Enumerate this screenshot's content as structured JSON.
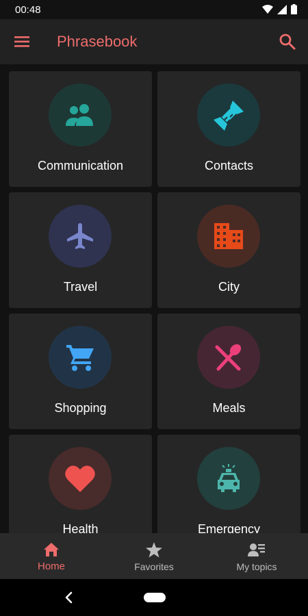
{
  "status_bar": {
    "time": "00:48",
    "icons": [
      "wifi-icon",
      "signal-icon",
      "battery-icon"
    ]
  },
  "app_bar": {
    "title": "Phrasebook",
    "menu_icon": "hamburger-menu-icon",
    "search_icon": "search-icon",
    "accent_color": "#ef6c6c"
  },
  "topics": [
    {
      "label": "Communication",
      "icon": "people-icon",
      "icon_color": "#26a69a",
      "circle_color": "#1d3936"
    },
    {
      "label": "Contacts",
      "icon": "handshake-icon",
      "icon_color": "#26c6da",
      "circle_color": "#1b3a3d"
    },
    {
      "label": "Travel",
      "icon": "airplane-icon",
      "icon_color": "#7986cb",
      "circle_color": "#2f3350"
    },
    {
      "label": "City",
      "icon": "city-building-icon",
      "icon_color": "#e64a19",
      "circle_color": "#4a2b24"
    },
    {
      "label": "Shopping",
      "icon": "shopping-cart-icon",
      "icon_color": "#42a5f5",
      "circle_color": "#213447"
    },
    {
      "label": "Meals",
      "icon": "fork-spoon-icon",
      "icon_color": "#ec407a",
      "circle_color": "#472634"
    },
    {
      "label": "Health",
      "icon": "heart-icon",
      "icon_color": "#ef5350",
      "circle_color": "#482b2b"
    },
    {
      "label": "Emergency",
      "icon": "police-car-icon",
      "icon_color": "#4db6ac",
      "circle_color": "#22403d"
    }
  ],
  "bottom_nav": {
    "items": [
      {
        "label": "Home",
        "icon": "home-icon",
        "active": true
      },
      {
        "label": "Favorites",
        "icon": "star-icon",
        "active": false
      },
      {
        "label": "My topics",
        "icon": "person-list-icon",
        "active": false
      }
    ]
  },
  "system_nav": {
    "back_icon": "back-chevron-icon",
    "home_icon": "home-pill-icon"
  }
}
